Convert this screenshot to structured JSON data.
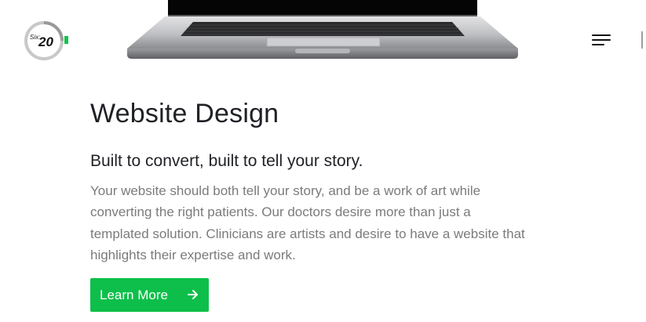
{
  "brand": {
    "logo_small": "Six:",
    "logo_number": "20",
    "accent": "#12c44a"
  },
  "header": {
    "menu_icon": "hamburger-menu-icon"
  },
  "hero": {
    "image": "laptop-image"
  },
  "section": {
    "title": "Website Design",
    "subtitle": "Built to convert, built to tell your story.",
    "body_lines": [
      "Your website should both tell your story, and be a work of art while",
      "converting the right patients. Our doctors desire more than just a",
      "templated solution. Clinicians are artists and desire to have a website that",
      "highlights their expertise and work."
    ],
    "cta_label": "Learn More",
    "cta_icon": "arrow-right-icon",
    "cta_color": "#0dbf4a"
  }
}
